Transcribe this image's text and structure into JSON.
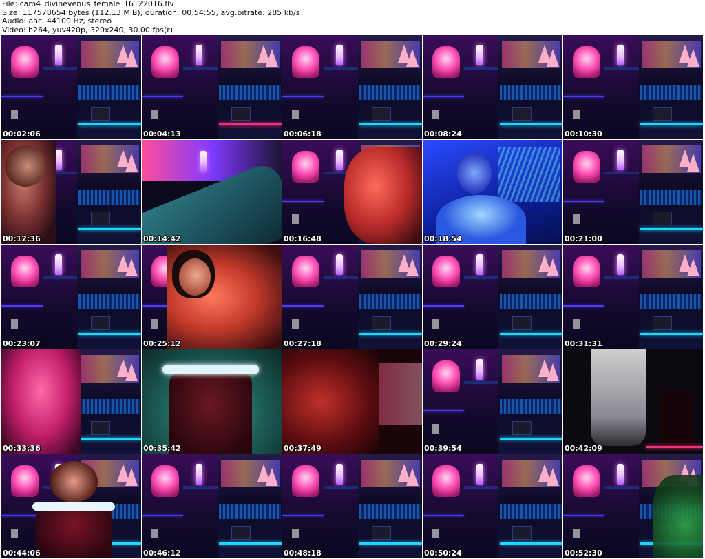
{
  "header": {
    "file_line": "File: cam4_divinevenus_female_16122016.flv",
    "size_line": "Size: 117578654 bytes (112.13 MiB), duration: 00:54:55, avg.bitrate: 285 kb/s",
    "audio_line": "Audio: aac, 44100 Hz, stereo",
    "video_line": "Video: h264, yuv420p, 320x240, 30.00 fps(r)"
  },
  "thumbnails": [
    {
      "timestamp": "00:02:06",
      "scene": "bar"
    },
    {
      "timestamp": "00:04:13",
      "scene": "bar-pink"
    },
    {
      "timestamp": "00:06:18",
      "scene": "bar"
    },
    {
      "timestamp": "00:08:24",
      "scene": "bar"
    },
    {
      "timestamp": "00:10:30",
      "scene": "bar"
    },
    {
      "timestamp": "00:12:36",
      "scene": "person-left"
    },
    {
      "timestamp": "00:14:42",
      "scene": "teal-closeup"
    },
    {
      "timestamp": "00:16:48",
      "scene": "red-closeup"
    },
    {
      "timestamp": "00:18:54",
      "scene": "blue-person"
    },
    {
      "timestamp": "00:21:00",
      "scene": "bar"
    },
    {
      "timestamp": "00:23:07",
      "scene": "bar"
    },
    {
      "timestamp": "00:25:12",
      "scene": "person-face"
    },
    {
      "timestamp": "00:27:18",
      "scene": "bar"
    },
    {
      "timestamp": "00:29:24",
      "scene": "bar"
    },
    {
      "timestamp": "00:31:31",
      "scene": "bar"
    },
    {
      "timestamp": "00:33:36",
      "scene": "pink-closeup"
    },
    {
      "timestamp": "00:35:42",
      "scene": "costume"
    },
    {
      "timestamp": "00:37:49",
      "scene": "red-dark"
    },
    {
      "timestamp": "00:39:54",
      "scene": "bar-dark"
    },
    {
      "timestamp": "00:42:09",
      "scene": "dark-shirt"
    },
    {
      "timestamp": "00:44:06",
      "scene": "person-costume"
    },
    {
      "timestamp": "00:46:12",
      "scene": "bar"
    },
    {
      "timestamp": "00:48:18",
      "scene": "bar"
    },
    {
      "timestamp": "00:50:24",
      "scene": "bar"
    },
    {
      "timestamp": "00:52:30",
      "scene": "bar-green"
    }
  ]
}
